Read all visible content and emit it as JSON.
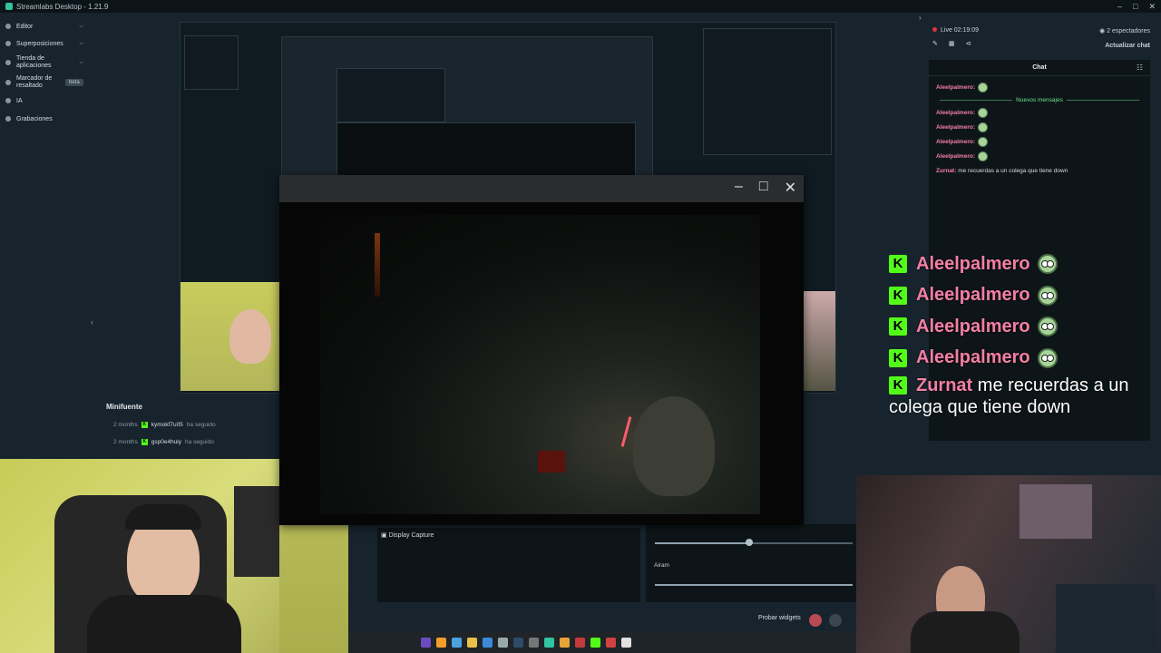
{
  "window": {
    "title": "Streamlabs Desktop - 1.21.9"
  },
  "sidebar": {
    "items": [
      {
        "label": "Editor"
      },
      {
        "label": "Superposiciones"
      },
      {
        "label": "Tienda de aplicaciones"
      },
      {
        "label": "Marcador de resaltado",
        "badge": "beta"
      },
      {
        "label": "IA"
      },
      {
        "label": "Grabaciones"
      }
    ]
  },
  "live": {
    "label": "Live 02:19:09",
    "viewers": "2 espectadores",
    "refresh_label": "Actualizar chat"
  },
  "chat": {
    "title": "Chat",
    "first": {
      "user": "Aleelpalmero:"
    },
    "new_messages_label": "Nuevos mensajes",
    "messages": [
      {
        "user": "Aleelpalmero:"
      },
      {
        "user": "Aleelpalmero:"
      },
      {
        "user": "Aleelpalmero:"
      },
      {
        "user": "Aleelpalmero:"
      }
    ],
    "last": {
      "user": "Zurnat:",
      "text": "me recuerdas a un colega que tiene down"
    }
  },
  "overlay_chat": {
    "messages": [
      {
        "user": "Aleelpalmero"
      },
      {
        "user": "Aleelpalmero"
      },
      {
        "user": "Aleelpalmero"
      },
      {
        "user": "Aleelpalmero"
      }
    ],
    "last": {
      "user": "Zurnat",
      "text": "me recuerdas a un",
      "text2": "colega que tiene down"
    }
  },
  "minifuente": {
    "title": "Minifuente",
    "rows": [
      {
        "time": "2 months",
        "user": "kymokf7u05",
        "action": "ha seguido"
      },
      {
        "time": "2 months",
        "user": "gsp0e4huly",
        "action": "ha seguido"
      }
    ]
  },
  "sources": {
    "display_capture": "Display Capture"
  },
  "mixer": {
    "label": "Airam"
  },
  "footer": {
    "probar_widgets": "Probar widgets"
  },
  "colors": {
    "accent": "#31c3a2",
    "kick_green": "#53fc18",
    "username_pink": "#f47fa4",
    "new_msg_green": "#69e38c"
  }
}
